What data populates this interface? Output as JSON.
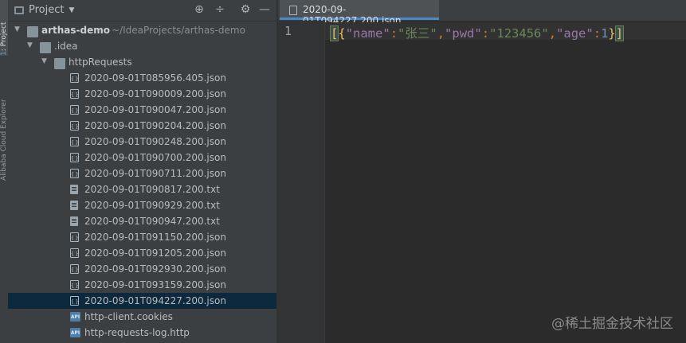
{
  "sidebar_tabs": {
    "project": {
      "number": "1",
      "label": ": Project"
    },
    "cloud_explorer": "Alibaba Cloud Explorer"
  },
  "project_panel": {
    "title": "Project",
    "tree": [
      {
        "label": "arthas-demo",
        "path": "~/IdeaProjects/arthas-demo",
        "type": "module-folder",
        "depth": 0,
        "expanded": true
      },
      {
        "label": ".idea",
        "type": "folder",
        "depth": 1,
        "expanded": true
      },
      {
        "label": "httpRequests",
        "type": "folder",
        "depth": 2,
        "expanded": true
      },
      {
        "label": "2020-09-01T085956.405.json",
        "type": "json",
        "depth": 3
      },
      {
        "label": "2020-09-01T090009.200.json",
        "type": "json",
        "depth": 3
      },
      {
        "label": "2020-09-01T090047.200.json",
        "type": "json",
        "depth": 3
      },
      {
        "label": "2020-09-01T090204.200.json",
        "type": "json",
        "depth": 3
      },
      {
        "label": "2020-09-01T090248.200.json",
        "type": "json",
        "depth": 3
      },
      {
        "label": "2020-09-01T090700.200.json",
        "type": "json",
        "depth": 3
      },
      {
        "label": "2020-09-01T090711.200.json",
        "type": "json",
        "depth": 3
      },
      {
        "label": "2020-09-01T090817.200.txt",
        "type": "txt",
        "depth": 3
      },
      {
        "label": "2020-09-01T090929.200.txt",
        "type": "txt",
        "depth": 3
      },
      {
        "label": "2020-09-01T090947.200.txt",
        "type": "txt",
        "depth": 3
      },
      {
        "label": "2020-09-01T091150.200.json",
        "type": "json",
        "depth": 3
      },
      {
        "label": "2020-09-01T091205.200.json",
        "type": "json",
        "depth": 3
      },
      {
        "label": "2020-09-01T092930.200.json",
        "type": "json",
        "depth": 3
      },
      {
        "label": "2020-09-01T093159.200.json",
        "type": "json",
        "depth": 3
      },
      {
        "label": "2020-09-01T094227.200.json",
        "type": "json",
        "depth": 3,
        "selected": true
      },
      {
        "label": "http-client.cookies",
        "type": "api",
        "depth": 3
      },
      {
        "label": "http-requests-log.http",
        "type": "api",
        "depth": 3
      }
    ]
  },
  "editor": {
    "tab_label": "2020-09-01T094227.200.json",
    "line_number": "1",
    "code": {
      "open": "[",
      "obj_open": "{",
      "key1": "\"name\"",
      "val1": "\"张三\"",
      "key2": "\"pwd\"",
      "val2": "\"123456\"",
      "key3": "\"age\"",
      "val3": "1",
      "obj_close": "}",
      "close": "]",
      "colon": ":",
      "comma": ","
    }
  },
  "watermark": "@稀土掘金技术社区"
}
